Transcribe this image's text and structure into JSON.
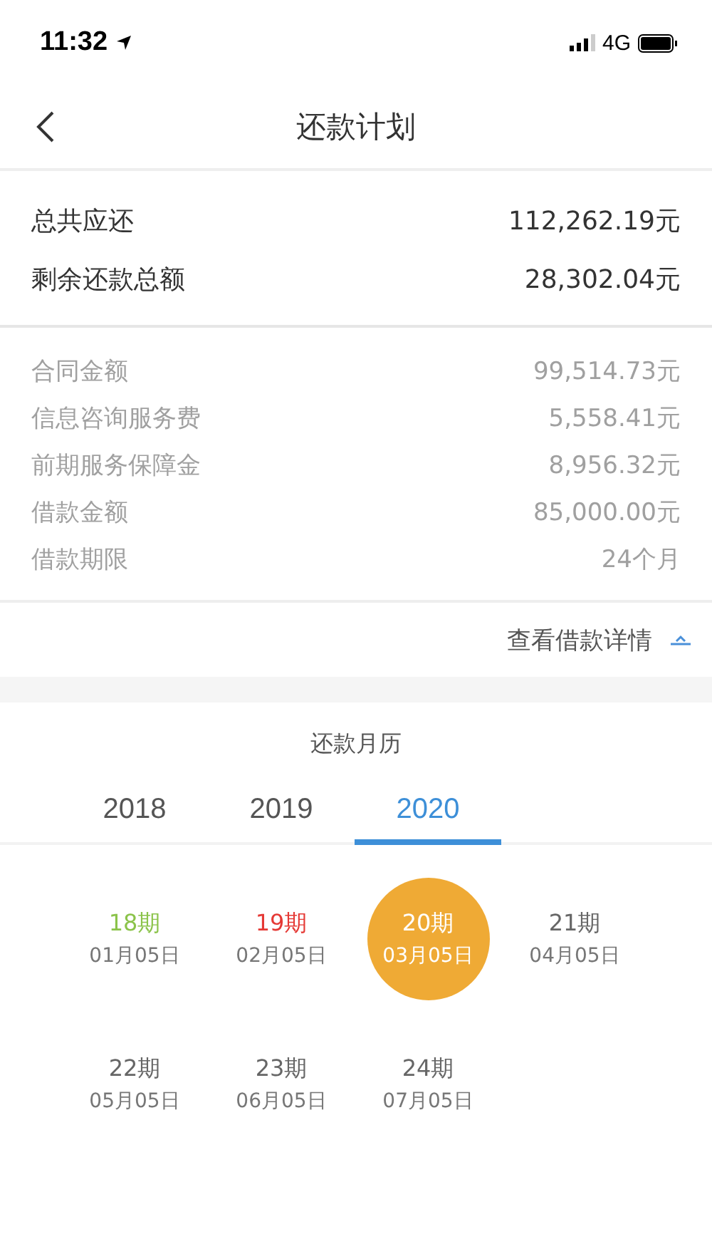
{
  "status_bar": {
    "time": "11:32",
    "network": "4G"
  },
  "nav": {
    "title": "还款计划"
  },
  "summary": [
    {
      "label": "总共应还",
      "value": "112,262.19元"
    },
    {
      "label": "剩余还款总额",
      "value": "28,302.04元"
    }
  ],
  "details": [
    {
      "label": "合同金额",
      "value": "99,514.73元"
    },
    {
      "label": "信息咨询服务费",
      "value": "5,558.41元"
    },
    {
      "label": "前期服务保障金",
      "value": "8,956.32元"
    },
    {
      "label": "借款金额",
      "value": "85,000.00元"
    },
    {
      "label": "借款期限",
      "value": "24个月"
    }
  ],
  "details_toggle": {
    "label": "查看借款详情",
    "expanded": true
  },
  "calendar": {
    "title": "还款月历",
    "tabs": [
      {
        "label": "2018",
        "selected": false
      },
      {
        "label": "2019",
        "selected": false
      },
      {
        "label": "2020",
        "selected": true
      }
    ],
    "periods": [
      {
        "term": "18期",
        "date": "01月05日",
        "kind": "paid",
        "selected": false
      },
      {
        "term": "19期",
        "date": "02月05日",
        "kind": "overdue",
        "selected": false
      },
      {
        "term": "20期",
        "date": "03月05日",
        "kind": "upcoming",
        "selected": true
      },
      {
        "term": "21期",
        "date": "04月05日",
        "kind": "upcoming",
        "selected": false
      },
      {
        "term": "22期",
        "date": "05月05日",
        "kind": "upcoming",
        "selected": false
      },
      {
        "term": "23期",
        "date": "06月05日",
        "kind": "upcoming",
        "selected": false
      },
      {
        "term": "24期",
        "date": "07月05日",
        "kind": "upcoming",
        "selected": false
      }
    ]
  }
}
